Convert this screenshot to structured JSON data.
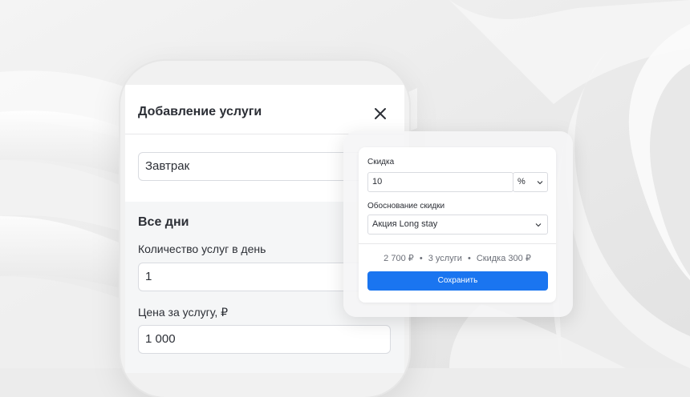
{
  "dialog": {
    "title": "Добавление услуги",
    "service_name_value": "Завтрак"
  },
  "schedule": {
    "section_title": "Все дни",
    "quantity_label": "Количество услуг в день",
    "quantity_value": "1",
    "price_label": "Цена за услугу, ₽",
    "price_value": "1 000"
  },
  "discount_popover": {
    "discount_label": "Скидка",
    "discount_value": "10",
    "unit_selected": "%",
    "reason_label": "Обоснование скидки",
    "reason_selected": "Акция Long stay",
    "summary": {
      "total": "2 700 ₽",
      "services": "3 услуги",
      "discount": "Скидка 300 ₽"
    },
    "save_label": "Сохранить"
  },
  "colors": {
    "accent": "#1a75f0",
    "text": "#2c2f36",
    "muted": "#6b6f78",
    "border": "#d9dbe0",
    "background": "#ececec"
  },
  "icons": {
    "close": "close-icon",
    "chevron": "chevron-down-icon",
    "bullet": "•"
  }
}
